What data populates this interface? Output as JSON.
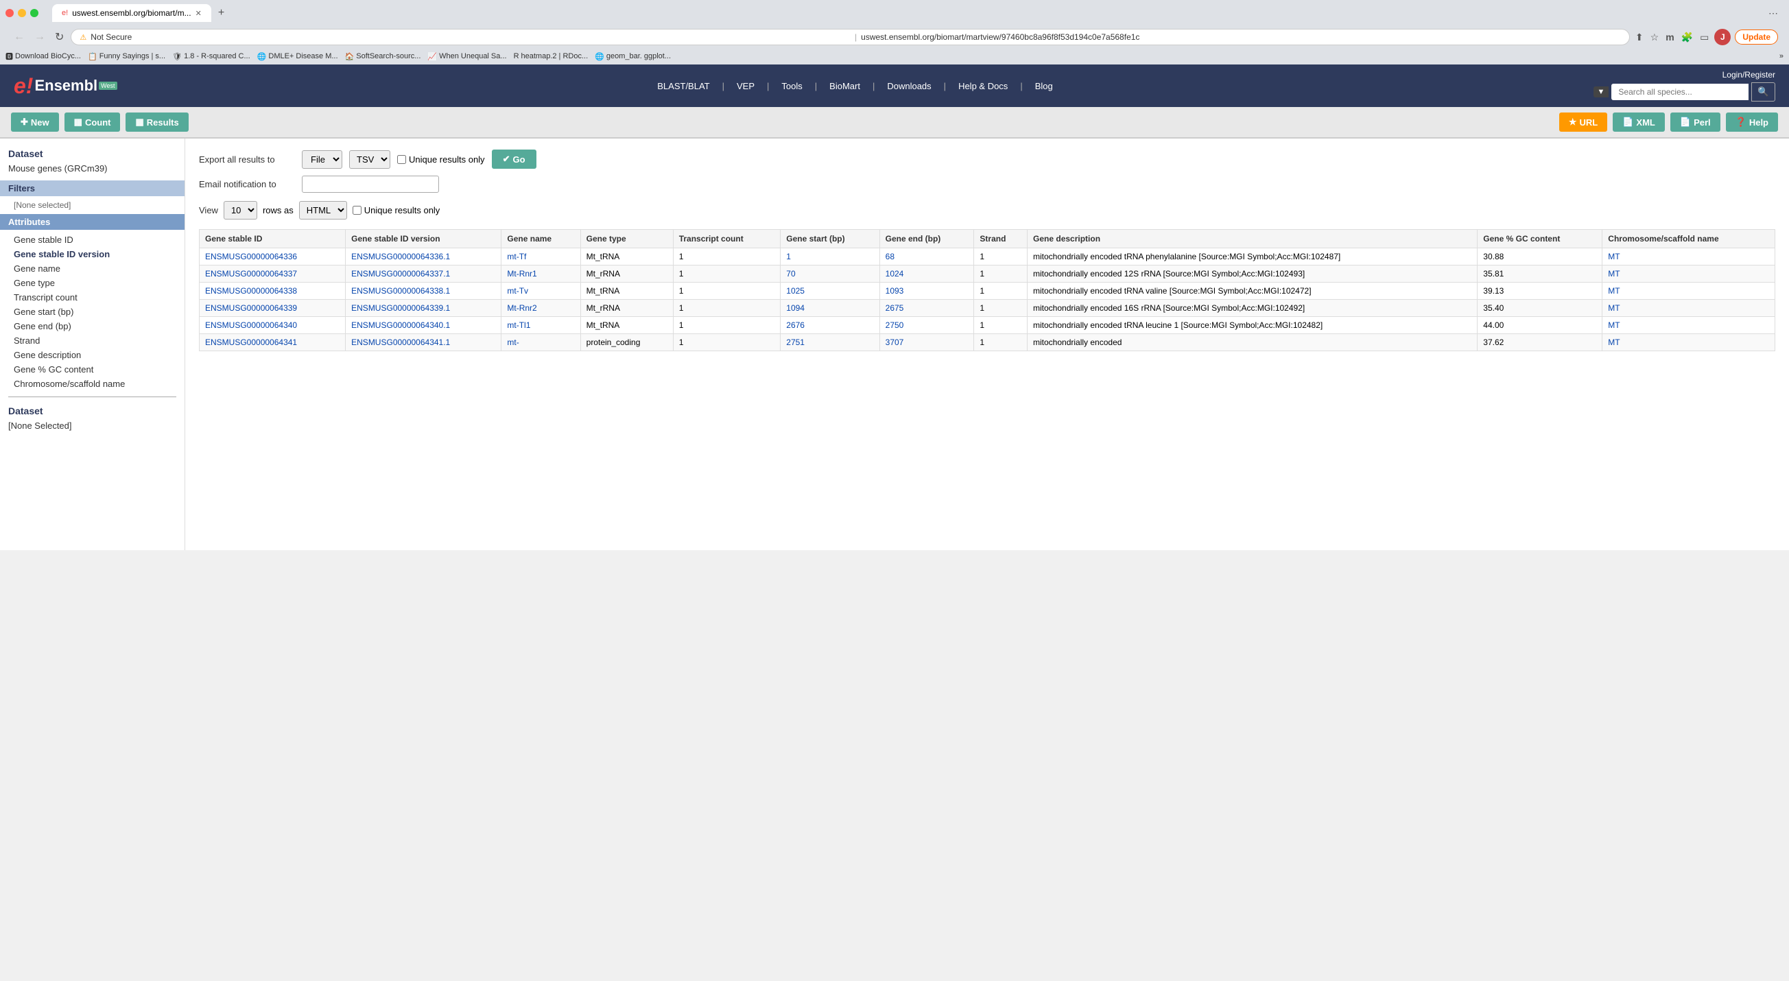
{
  "browser": {
    "tab_title": "uswest.ensembl.org/biomart/m...",
    "tab_favicon": "e!",
    "address": "uswest.ensembl.org/biomart/martview/97460bc8a96f8f53d194c0e7a568fe1c",
    "address_security": "Not Secure",
    "new_tab_label": "+",
    "update_btn_label": "Update",
    "bookmarks": [
      "Download BioCyc...",
      "Funny Sayings | s...",
      "1.8 - R-squared C...",
      "DMLE+ Disease M...",
      "SoftSearch-sourc...",
      "When Unequal Sa...",
      "heatmap.2 | RDoc...",
      "geom_bar. ggplot..."
    ]
  },
  "header": {
    "logo_e": "e!",
    "logo_text": "Ensembl",
    "logo_badge": "West",
    "login_register": "Login/Register",
    "nav_items": [
      "BLAST/BLAT",
      "VEP",
      "Tools",
      "BioMart",
      "Downloads",
      "Help & Docs",
      "Blog"
    ],
    "search_placeholder": "Search all species..."
  },
  "toolbar": {
    "new_label": "New",
    "count_label": "Count",
    "results_label": "Results",
    "url_label": "URL",
    "xml_label": "XML",
    "perl_label": "Perl",
    "help_label": "Help"
  },
  "sidebar": {
    "dataset_title": "Dataset",
    "dataset_value": "Mouse genes (GRCm39)",
    "filters_title": "Filters",
    "filters_selected": "[None selected]",
    "attributes_title": "Attributes",
    "attribute_items": [
      "Gene stable ID",
      "Gene stable ID version",
      "Gene name",
      "Gene type",
      "Transcript count",
      "Gene start (bp)",
      "Gene end (bp)",
      "Strand",
      "Gene description",
      "Gene % GC content",
      "Chromosome/scaffold name"
    ],
    "dataset2_title": "Dataset",
    "dataset2_selected": "[None Selected]"
  },
  "export": {
    "export_label": "Export  all results to",
    "file_option": "File",
    "tsv_option": "TSV",
    "unique_label": "Unique results only",
    "go_label": "Go",
    "email_label": "Email notification to",
    "email_placeholder": ""
  },
  "view": {
    "view_label": "View",
    "rows_count": "10",
    "rows_as_label": "rows as",
    "format_option": "HTML",
    "unique_label": "Unique results only"
  },
  "table": {
    "columns": [
      "Gene stable ID",
      "Gene stable ID version",
      "Gene name",
      "Gene type",
      "Transcript count",
      "Gene start (bp)",
      "Gene end (bp)",
      "Strand",
      "Gene description",
      "Gene % GC content",
      "Chromosome/scaffold name"
    ],
    "rows": [
      {
        "gene_stable_id": "ENSMUSG00000064336",
        "gene_stable_id_version": "ENSMUSG00000064336.1",
        "gene_name": "mt-Tf",
        "gene_type": "Mt_tRNA",
        "transcript_count": "1",
        "gene_start": "1",
        "gene_end": "68",
        "strand": "1",
        "gene_description": "mitochondrially encoded tRNA phenylalanine [Source:MGI Symbol;Acc:MGI:102487]",
        "gc_content": "30.88",
        "scaffold_name": "MT"
      },
      {
        "gene_stable_id": "ENSMUSG00000064337",
        "gene_stable_id_version": "ENSMUSG00000064337.1",
        "gene_name": "Mt-Rnr1",
        "gene_type": "Mt_rRNA",
        "transcript_count": "1",
        "gene_start": "70",
        "gene_end": "1024",
        "strand": "1",
        "gene_description": "mitochondrially encoded 12S rRNA [Source:MGI Symbol;Acc:MGI:102493]",
        "gc_content": "35.81",
        "scaffold_name": "MT"
      },
      {
        "gene_stable_id": "ENSMUSG00000064338",
        "gene_stable_id_version": "ENSMUSG00000064338.1",
        "gene_name": "mt-Tv",
        "gene_type": "Mt_tRNA",
        "transcript_count": "1",
        "gene_start": "1025",
        "gene_end": "1093",
        "strand": "1",
        "gene_description": "mitochondrially encoded tRNA valine [Source:MGI Symbol;Acc:MGI:102472]",
        "gc_content": "39.13",
        "scaffold_name": "MT"
      },
      {
        "gene_stable_id": "ENSMUSG00000064339",
        "gene_stable_id_version": "ENSMUSG00000064339.1",
        "gene_name": "Mt-Rnr2",
        "gene_type": "Mt_rRNA",
        "transcript_count": "1",
        "gene_start": "1094",
        "gene_end": "2675",
        "strand": "1",
        "gene_description": "mitochondrially encoded 16S rRNA [Source:MGI Symbol;Acc:MGI:102492]",
        "gc_content": "35.40",
        "scaffold_name": "MT"
      },
      {
        "gene_stable_id": "ENSMUSG00000064340",
        "gene_stable_id_version": "ENSMUSG00000064340.1",
        "gene_name": "mt-Tl1",
        "gene_type": "Mt_tRNA",
        "transcript_count": "1",
        "gene_start": "2676",
        "gene_end": "2750",
        "strand": "1",
        "gene_description": "mitochondrially encoded tRNA leucine 1 [Source:MGI Symbol;Acc:MGI:102482]",
        "gc_content": "44.00",
        "scaffold_name": "MT"
      },
      {
        "gene_stable_id": "ENSMUSG00000064341",
        "gene_stable_id_version": "ENSMUSG00000064341.1",
        "gene_name": "mt-",
        "gene_type": "protein_coding",
        "transcript_count": "1",
        "gene_start": "2751",
        "gene_end": "3707",
        "strand": "1",
        "gene_description": "mitochondrially encoded",
        "gc_content": "37.62",
        "scaffold_name": "MT"
      }
    ]
  }
}
